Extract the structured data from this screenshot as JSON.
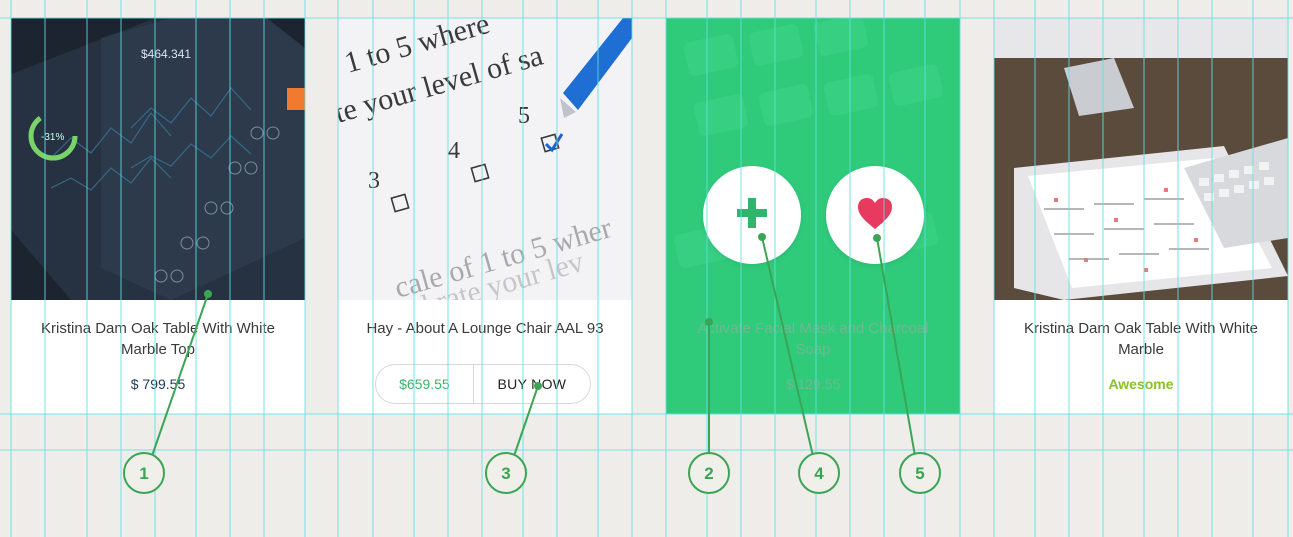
{
  "colors": {
    "background": "#efedea",
    "green_card": "#2fcb7b",
    "guide_lines": "#5fe0e6",
    "annotation": "#3aa555",
    "heart": "#e8395f",
    "awesome": "#85c226"
  },
  "cards": [
    {
      "title": "Kristina Dam Oak Table With White Marble Top",
      "price": "$ 799.55",
      "image": "dashboard-dark-ui-photo"
    },
    {
      "title": "Hay - About A Lounge Chair AAL 93",
      "price": "$659.55",
      "buy_label": "BUY NOW",
      "image": "survey-form-pen-photo"
    },
    {
      "title": "Activate Facial Mask and Charcoal Soap",
      "price": "$ 129.55",
      "add_icon": "plus-icon",
      "fav_icon": "heart-icon",
      "image": "keyboard-green-overlay-photo"
    },
    {
      "title": "Kristina Dam Oak Table With White Marble",
      "badge": "Awesome",
      "image": "desk-computer-tablet-photo"
    }
  ],
  "annotations": [
    "1",
    "3",
    "2",
    "4",
    "5"
  ]
}
